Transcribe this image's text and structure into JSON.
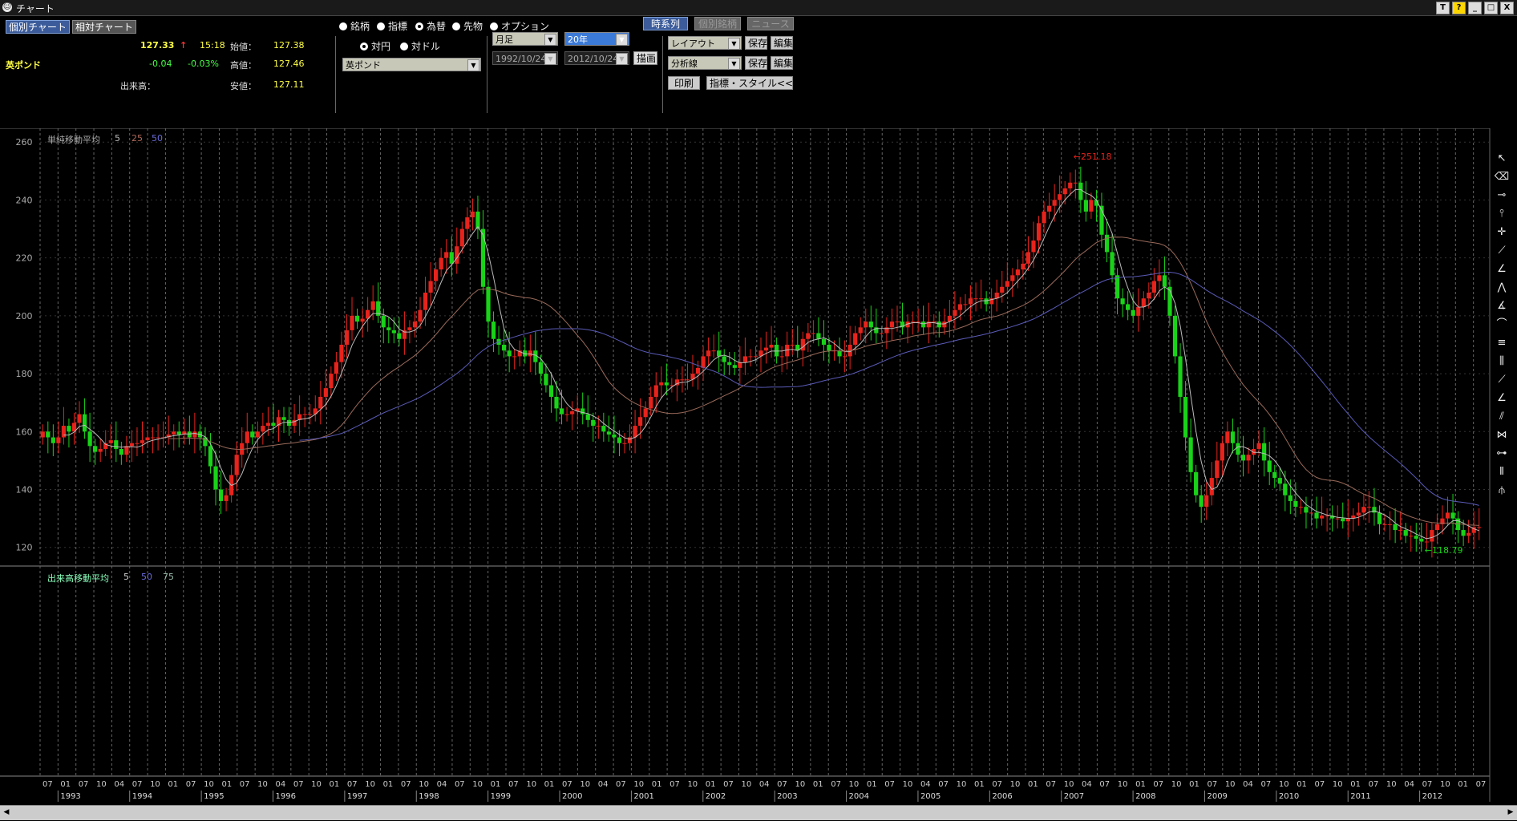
{
  "window": {
    "title": "チャート",
    "buttons": [
      "T",
      "?",
      "_",
      "□",
      "X"
    ]
  },
  "tabs": {
    "individual": "個別チャート",
    "relative": "相対チャート"
  },
  "quote": {
    "name": "英ポンド",
    "price": "127.33",
    "arrow": "↑",
    "time": "15:18",
    "change": "-0.04",
    "change_pct": "-0.03%",
    "volume_label": "出来高：",
    "open_label": "始値：",
    "open": "127.38",
    "high_label": "高値：",
    "high": "127.46",
    "low_label": "安値：",
    "low": "127.11"
  },
  "category_radios": [
    "銘柄",
    "指標",
    "為替",
    "先物",
    "オプション"
  ],
  "category_selected": 2,
  "currency_radios": [
    "対円",
    "対ドル"
  ],
  "currency_selected": 0,
  "symbol_select": "英ポンド",
  "controls": {
    "period": "月足",
    "span": "20年",
    "from": "1992/10/24",
    "to": "2012/10/24",
    "draw": "描画",
    "timeseries": "時系列",
    "stock_tab": "個別銘柄",
    "news": "ニュース",
    "layout": "レイアウト",
    "analysis": "分析線",
    "save": "保存",
    "edit": "編集",
    "print": "印刷",
    "style": "指標・スタイル<<"
  },
  "indicator_labels": {
    "ma": "単純移動平均",
    "ma1": "5",
    "ma2": "25",
    "ma3": "50",
    "vol": "出来高移動平均",
    "vol1": "5",
    "vol2": "50",
    "vol3": "75"
  },
  "colors": {
    "up": "#e8231c",
    "down": "#19d318",
    "ma5": "#bbbbbb",
    "ma25": "#9a6a5a",
    "ma50": "#5a5ab8",
    "grid": "#aaaaaa"
  },
  "chart_data": {
    "type": "candlestick",
    "title": "",
    "y_ticks": [
      120,
      140,
      160,
      180,
      200,
      220,
      240,
      260
    ],
    "ylim": [
      113,
      262
    ],
    "annotations": {
      "high": "←251.18",
      "low": "←118.79"
    },
    "years": [
      "1993",
      "1994",
      "1995",
      "1996",
      "1997",
      "1998",
      "1999",
      "2000",
      "2001",
      "2002",
      "2003",
      "2004",
      "2005",
      "2006",
      "2007",
      "2008",
      "2009",
      "2010",
      "2011",
      "2012"
    ],
    "first_year": "1993",
    "last_year": "2012",
    "x_month_ticks": [
      "07",
      "01",
      "07",
      "10",
      "04",
      "07",
      "10",
      "01",
      "07",
      "10",
      "01",
      "07",
      "10",
      "04",
      "07",
      "10",
      "01",
      "07",
      "10",
      "01",
      "07",
      "10",
      "04",
      "07",
      "10",
      "01",
      "07",
      "10",
      "01",
      "07",
      "10",
      "04",
      "07",
      "10",
      "01",
      "07",
      "10",
      "01",
      "07",
      "10",
      "04",
      "07",
      "10",
      "01",
      "07",
      "10",
      "01",
      "07",
      "10",
      "04",
      "07",
      "10",
      "01",
      "07",
      "10",
      "01",
      "07",
      "10",
      "04",
      "07",
      "10",
      "01",
      "07",
      "10",
      "01",
      "07",
      "10",
      "04",
      "07",
      "10",
      "01",
      "07",
      "10",
      "01",
      "07",
      "10",
      "04",
      "07",
      "10",
      "01",
      "07"
    ],
    "monthly_close": [
      160,
      158,
      156,
      158,
      162,
      160,
      163,
      166,
      160,
      155,
      153,
      154,
      156,
      157,
      154,
      152,
      155,
      156,
      156,
      157,
      158,
      158,
      158,
      158,
      159,
      160,
      159,
      160,
      158,
      160,
      158,
      155,
      148,
      140,
      136,
      138,
      145,
      152,
      156,
      160,
      158,
      160,
      162,
      163,
      162,
      165,
      164,
      162,
      164,
      166,
      166,
      166,
      168,
      172,
      175,
      180,
      184,
      190,
      195,
      200,
      198,
      199,
      202,
      205,
      200,
      196,
      195,
      194,
      192,
      195,
      196,
      198,
      202,
      208,
      212,
      216,
      220,
      222,
      218,
      224,
      230,
      234,
      236,
      230,
      210,
      198,
      192,
      190,
      188,
      186,
      186,
      188,
      186,
      188,
      184,
      180,
      176,
      172,
      168,
      166,
      166,
      167,
      168,
      166,
      164,
      162,
      162,
      160,
      159,
      158,
      156,
      156,
      158,
      162,
      165,
      168,
      172,
      176,
      177,
      176,
      176,
      178,
      178,
      178,
      180,
      182,
      186,
      188,
      188,
      186,
      184,
      183,
      182,
      184,
      186,
      186,
      186,
      188,
      189,
      190,
      186,
      186,
      190,
      190,
      188,
      192,
      194,
      194,
      192,
      190,
      188,
      188,
      186,
      186,
      190,
      194,
      196,
      198,
      196,
      194,
      194,
      196,
      198,
      198,
      196,
      198,
      198,
      198,
      196,
      198,
      198,
      196,
      198,
      200,
      202,
      204,
      204,
      206,
      206,
      206,
      204,
      206,
      208,
      210,
      212,
      214,
      216,
      218,
      222,
      226,
      232,
      236,
      238,
      240,
      242,
      244,
      246,
      246,
      240,
      236,
      240,
      238,
      228,
      222,
      214,
      206,
      204,
      202,
      200,
      203,
      206,
      208,
      212,
      214,
      210,
      200,
      186,
      172,
      158,
      146,
      138,
      134,
      138,
      144,
      150,
      156,
      160,
      156,
      152,
      150,
      152,
      154,
      156,
      150,
      146,
      144,
      142,
      138,
      136,
      134,
      134,
      132,
      132,
      130,
      131,
      131,
      130,
      130,
      129,
      130,
      131,
      132,
      134,
      134,
      132,
      128,
      128,
      128,
      126,
      126,
      124,
      124,
      123,
      122,
      122,
      126,
      128,
      130,
      132,
      130,
      126,
      124,
      125,
      127,
      127
    ]
  }
}
